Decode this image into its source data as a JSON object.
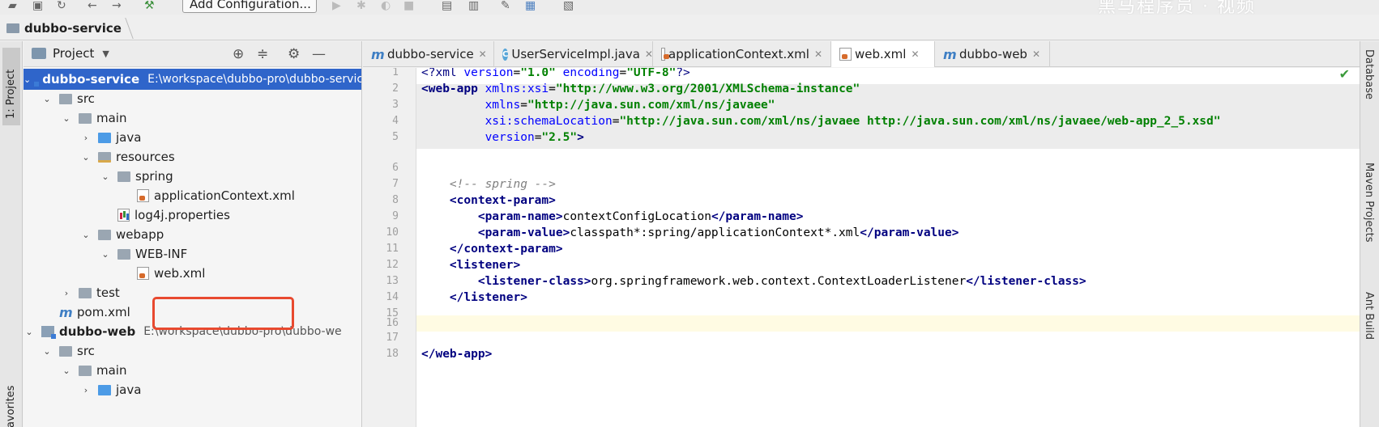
{
  "toolbar": {
    "add_configuration_label": "Add Configuration...",
    "watermark": "黑马程序员 · 视频"
  },
  "breadcrumb": {
    "project": "dubbo-service"
  },
  "left_strip": {
    "project_tab": "1: Project",
    "favorites_tab": "avorites"
  },
  "project_panel": {
    "title": "Project",
    "tree": [
      {
        "label": "dubbo-service",
        "path": "E:\\workspace\\dubbo-pro\\dubbo-service",
        "selected": true
      },
      {
        "label": "src"
      },
      {
        "label": "main"
      },
      {
        "label": "java"
      },
      {
        "label": "resources"
      },
      {
        "label": "spring"
      },
      {
        "label": "applicationContext.xml"
      },
      {
        "label": "log4j.properties"
      },
      {
        "label": "webapp"
      },
      {
        "label": "WEB-INF"
      },
      {
        "label": "web.xml"
      },
      {
        "label": "test"
      },
      {
        "label": "pom.xml"
      },
      {
        "label": "dubbo-web",
        "path": "E:\\workspace\\dubbo-pro\\dubbo-we"
      },
      {
        "label": "src"
      },
      {
        "label": "main"
      },
      {
        "label": "java"
      }
    ]
  },
  "tabs": [
    {
      "label": "dubbo-service",
      "icon": "maven-icon"
    },
    {
      "label": "UserServiceImpl.java",
      "icon": "class-icon"
    },
    {
      "label": "applicationContext.xml",
      "icon": "xml-file-icon"
    },
    {
      "label": "web.xml",
      "icon": "xml-file-icon",
      "active": true
    },
    {
      "label": "dubbo-web",
      "icon": "maven-icon"
    }
  ],
  "editor": {
    "line_numbers": [
      "1",
      "2",
      "3",
      "4",
      "5",
      "6",
      "7",
      "8",
      "9",
      "10",
      "11",
      "12",
      "13",
      "14",
      "15",
      "16",
      "17",
      "18"
    ],
    "lines": {
      "l1_a": "<?xml ",
      "l1_b": "version",
      "l1_c": "=",
      "l1_d": "\"1.0\"",
      "l1_e": " ",
      "l1_f": "encoding",
      "l1_g": "=",
      "l1_h": "\"UTF-8\"",
      "l1_i": "?>",
      "l2_a": "<web-app ",
      "l2_b": "xmlns:xsi",
      "l2_c": "=",
      "l2_d": "\"http://www.w3.org/2001/XMLSchema-instance\"",
      "l3_a": "         ",
      "l3_b": "xmlns",
      "l3_c": "=",
      "l3_d": "\"http://java.sun.com/xml/ns/javaee\"",
      "l4_a": "         ",
      "l4_b": "xsi:schemaLocation",
      "l4_c": "=",
      "l4_d": "\"http://java.sun.com/xml/ns/javaee http://java.sun.com/xml/ns/javaee/web-app_2_5.xsd\"",
      "l5_a": "         ",
      "l5_b": "version",
      "l5_c": "=",
      "l5_d": "\"2.5\"",
      "l5_e": ">",
      "l8": "    <!-- spring -->",
      "l9": "    <context-param>",
      "l10_a": "        <param-name>",
      "l10_b": "contextConfigLocation",
      "l10_c": "</param-name>",
      "l11_a": "        <param-value>",
      "l11_b": "classpath*:spring/applicationContext*.xml",
      "l11_c": "</param-value>",
      "l12": "    </context-param>",
      "l13": "    <listener>",
      "l14_a": "        <listener-class>",
      "l14_b": "org.springframework.web.context.ContextLoaderListener",
      "l14_c": "</listener-class>",
      "l15": "    </listener>",
      "l18": "</web-app>"
    }
  },
  "right_strip": {
    "database": "Database",
    "maven": "Maven Projects",
    "ant": "Ant Build"
  }
}
